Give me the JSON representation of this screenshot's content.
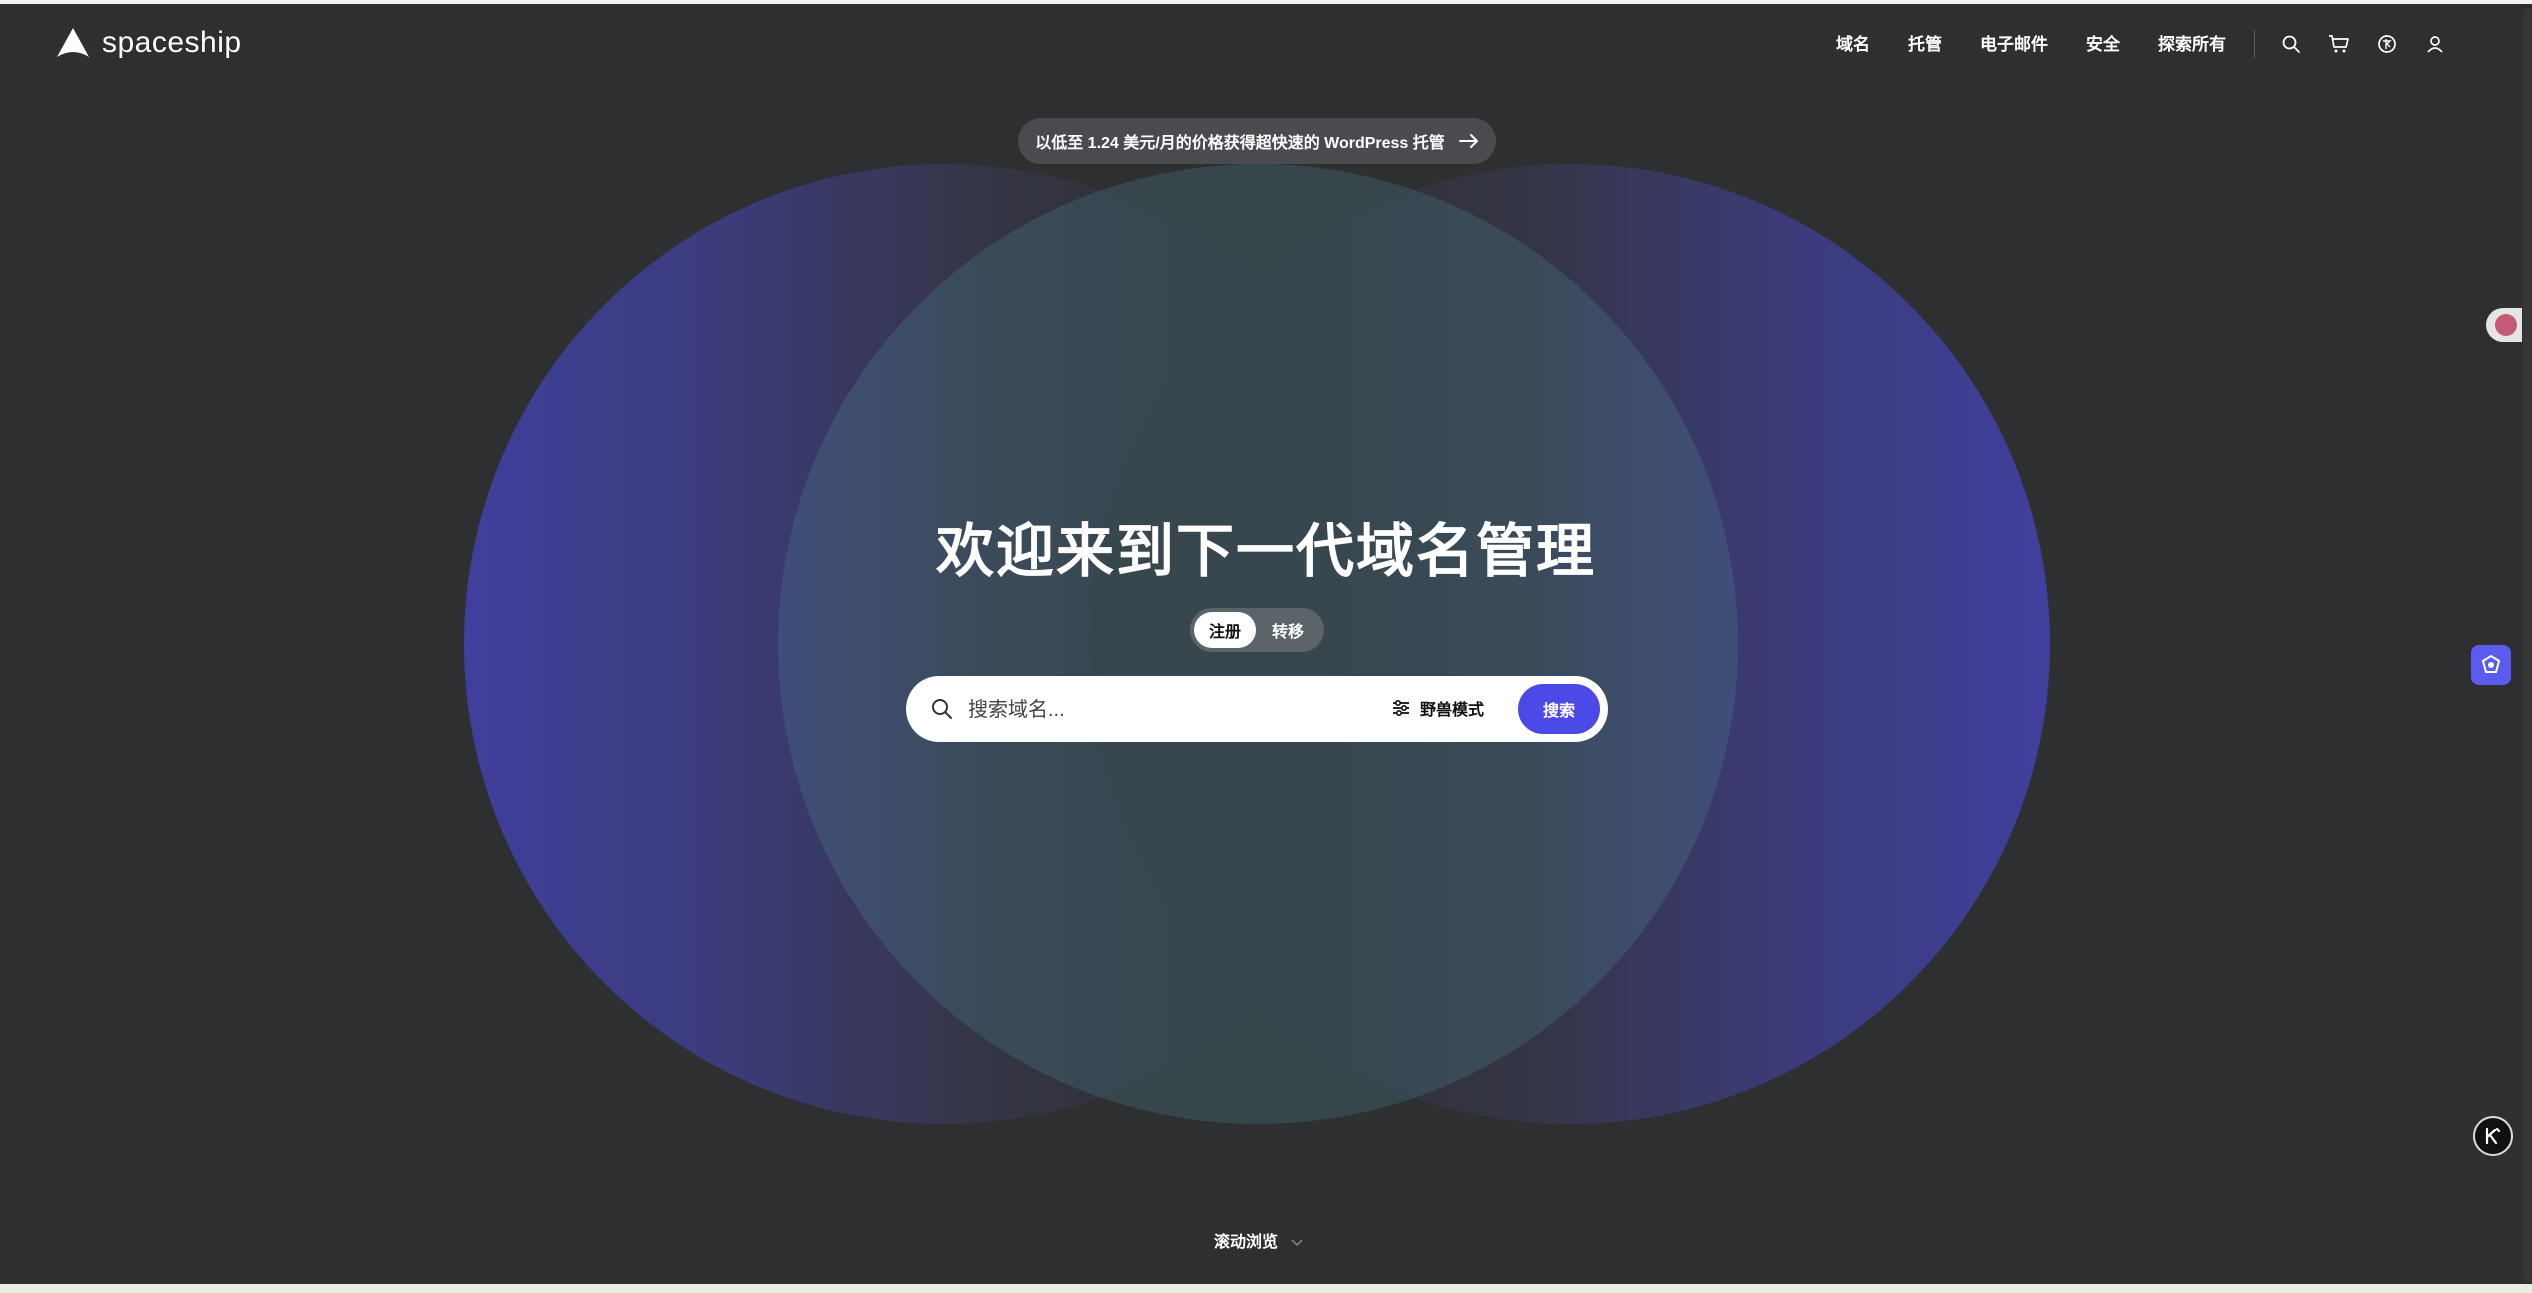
{
  "header": {
    "brand": "spaceship",
    "nav": [
      "域名",
      "托管",
      "电子邮件",
      "安全",
      "探索所有"
    ],
    "icons": [
      "search-icon",
      "cart-icon",
      "language-icon",
      "user-icon"
    ]
  },
  "banner": {
    "text": "以低至 1.24 美元/月的价格获得超快速的 WordPress 托管",
    "icon": "arrow-right-icon"
  },
  "hero": {
    "title": "欢迎来到下一代域名管理",
    "toggle": {
      "active": "注册",
      "inactive": "转移"
    },
    "search": {
      "placeholder": "搜索域名...",
      "value": "",
      "beast_mode_label": "野兽模式",
      "button_label": "搜索"
    }
  },
  "footer": {
    "scroll_hint": "滚动浏览"
  },
  "colors": {
    "background": "#2e2f31",
    "accent": "#4b4ae6",
    "circle_blue": "#403f9d",
    "circle_teal": "#5a9496"
  }
}
